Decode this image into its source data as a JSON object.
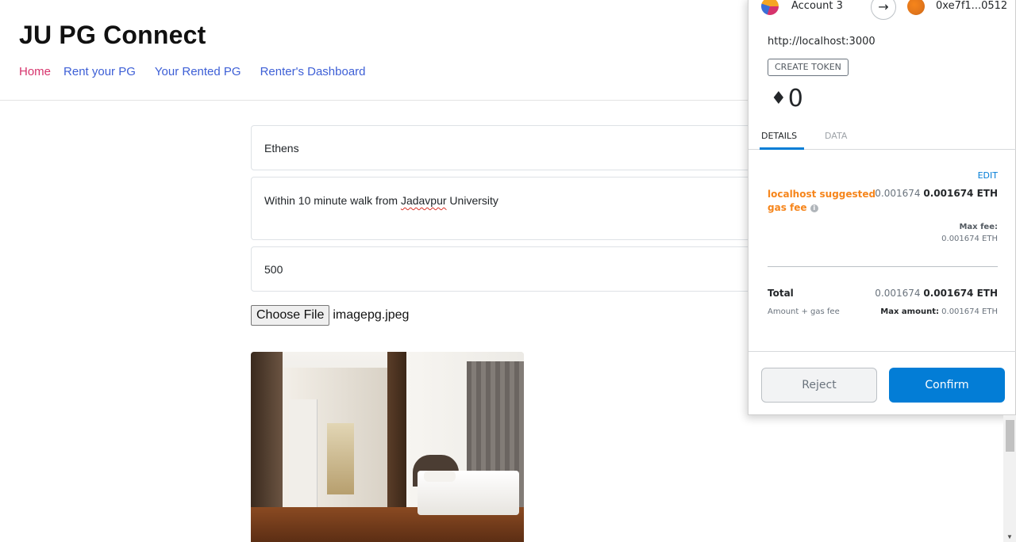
{
  "site": {
    "title": "JU PG Connect",
    "nav": [
      "Home",
      "Rent your PG",
      "Your Rented PG",
      "Renter's Dashboard"
    ],
    "active_nav": "Home"
  },
  "form": {
    "name_value": "Ethens",
    "description_prefix": "Within 10 minute walk from ",
    "description_misspelled": "Jadavpur",
    "description_suffix": " University",
    "price_value": "500",
    "file_button_label": "Choose File",
    "file_name": "imagepg.jpeg"
  },
  "preview_image": {
    "alt": "bedroom photo"
  },
  "metamask": {
    "account_name": "Account 3",
    "to_address": "0xe7f1...0512",
    "origin": "http://localhost:3000",
    "create_token_label": "CREATE TOKEN",
    "amount": "0",
    "tabs": [
      "DETAILS",
      "DATA"
    ],
    "active_tab": "DETAILS",
    "edit_label": "EDIT",
    "fee_label": "localhost suggested gas fee",
    "fee_value": "0.001674",
    "fee_value_eth": "0.001674 ETH",
    "max_fee_label": "Max fee:",
    "max_fee_value": "0.001674 ETH",
    "total_label": "Total",
    "total_value": "0.001674",
    "total_value_eth": "0.001674 ETH",
    "amount_gas_label": "Amount + gas fee",
    "max_amount_label": "Max amount:",
    "max_amount_value": "0.001674 ETH",
    "reject_label": "Reject",
    "confirm_label": "Confirm",
    "accent_color": "#037dd6",
    "fee_label_color": "#f6851b"
  }
}
